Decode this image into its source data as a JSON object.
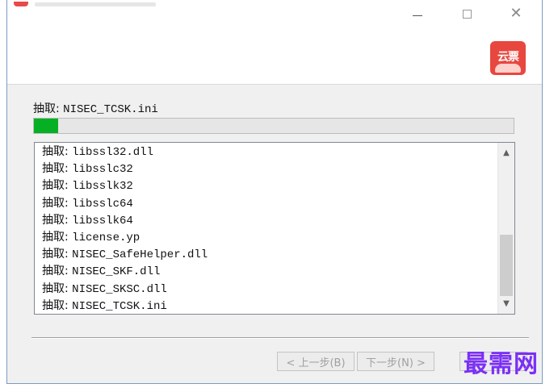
{
  "window": {
    "controls": {
      "minimize": "minimize-icon",
      "maximize": "maximize-icon",
      "close": "close-icon"
    },
    "logo_text": "云票"
  },
  "status": {
    "prefix": "抽取:",
    "file": "NISEC_TCSK.ini",
    "progress_percent": 5
  },
  "log": {
    "items": [
      {
        "prefix": "抽取:",
        "file": "libssl32.dll"
      },
      {
        "prefix": "抽取:",
        "file": "libsslc32"
      },
      {
        "prefix": "抽取:",
        "file": "libsslk32"
      },
      {
        "prefix": "抽取:",
        "file": "libsslc64"
      },
      {
        "prefix": "抽取:",
        "file": "libsslk64"
      },
      {
        "prefix": "抽取:",
        "file": "license.yp"
      },
      {
        "prefix": "抽取:",
        "file": "NISEC_SafeHelper.dll"
      },
      {
        "prefix": "抽取:",
        "file": "NISEC_SKF.dll"
      },
      {
        "prefix": "抽取:",
        "file": "NISEC_SKSC.dll"
      },
      {
        "prefix": "抽取:",
        "file": "NISEC_TCSK.ini"
      }
    ],
    "scroll_up": "▲",
    "scroll_down": "▼"
  },
  "buttons": {
    "prev": "< 上一步(B)",
    "next": "下一步(N) >",
    "third": "取"
  },
  "watermark": "最需网",
  "colors": {
    "progress": "#06b025",
    "logo": "#e8473f",
    "watermark": "#7b2ff7"
  }
}
